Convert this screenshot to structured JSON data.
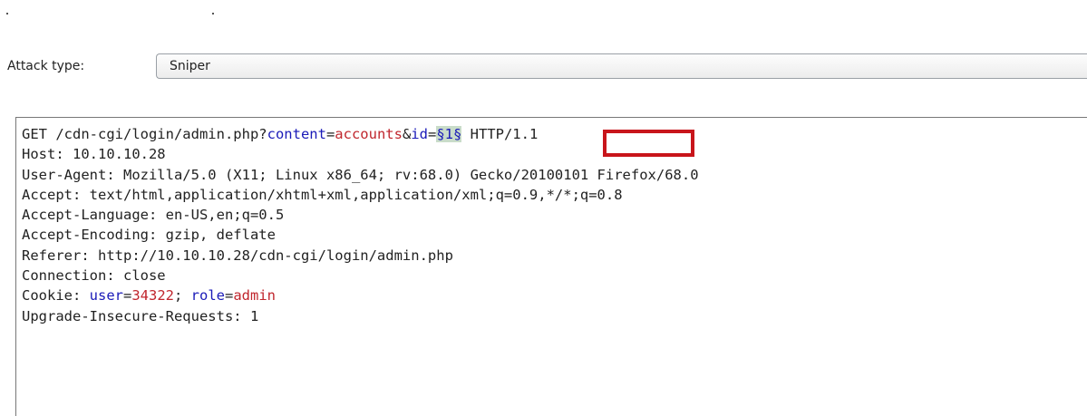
{
  "attack_type": {
    "label": "Attack type:",
    "value": "Sniper"
  },
  "request": {
    "line1": {
      "prefix": "GET /cdn-cgi/login/admin.php?",
      "p1_name": "content",
      "eq1": "=",
      "p1_value": "accounts",
      "amp": "&",
      "p2_name": "id",
      "eq2": "=",
      "payload": "§1§",
      "suffix": " HTTP/1.1"
    },
    "host": "Host: 10.10.10.28",
    "user_agent": "User-Agent: Mozilla/5.0 (X11; Linux x86_64; rv:68.0) Gecko/20100101 Firefox/68.0",
    "accept": "Accept: text/html,application/xhtml+xml,application/xml;q=0.9,*/*;q=0.8",
    "accept_language": "Accept-Language: en-US,en;q=0.5",
    "accept_encoding": "Accept-Encoding: gzip, deflate",
    "referer": "Referer: http://10.10.10.28/cdn-cgi/login/admin.php",
    "connection": "Connection: close",
    "cookie": {
      "prefix": "Cookie: ",
      "user_name": "user",
      "eq1": "=",
      "user_value": "34322",
      "sep": "; ",
      "role_name": "role",
      "eq2": "=",
      "role_value": "admin"
    },
    "upgrade": "Upgrade-Insecure-Requests: 1"
  },
  "colors": {
    "param_name": "#1a1ab8",
    "param_value": "#c0262d",
    "payload_bg": "#c9dcc9",
    "highlight_box": "#c8151b"
  }
}
